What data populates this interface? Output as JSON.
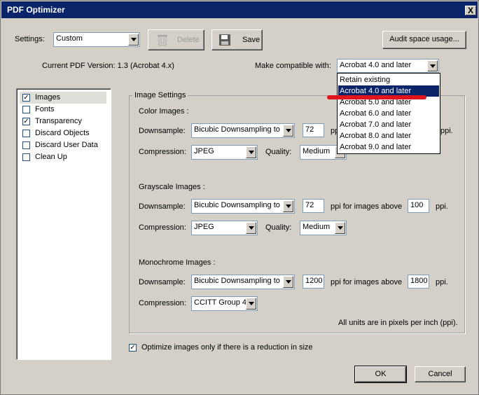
{
  "window": {
    "title": "PDF Optimizer",
    "close_glyph": "X"
  },
  "toolbar": {
    "settings_label": "Settings:",
    "settings_value": "Custom",
    "delete_label": "Delete",
    "save_label": "Save",
    "audit_label": "Audit space usage..."
  },
  "version": {
    "current": "Current PDF Version: 1.3 (Acrobat 4.x)",
    "compat_label": "Make compatible with:",
    "compat_value": "Acrobat 4.0 and later",
    "options": [
      "Retain existing",
      "Acrobat 4.0 and later",
      "Acrobat 5.0 and later",
      "Acrobat 6.0 and later",
      "Acrobat 7.0 and later",
      "Acrobat 8.0 and later",
      "Acrobat 9.0 and later"
    ]
  },
  "panels": [
    {
      "label": "Images",
      "checked": "✓"
    },
    {
      "label": "Fonts",
      "checked": ""
    },
    {
      "label": "Transparency",
      "checked": "✓"
    },
    {
      "label": "Discard Objects",
      "checked": ""
    },
    {
      "label": "Discard User Data",
      "checked": ""
    },
    {
      "label": "Clean Up",
      "checked": ""
    }
  ],
  "image_settings": {
    "group_label": "Image Settings",
    "color": {
      "header": "Color Images :",
      "downsample_label": "Downsample:",
      "downsample_value": "Bicubic Downsampling to",
      "ppi": "72",
      "ppi_above_label": "ppi for images above",
      "compression_label": "Compression:",
      "compression_value": "JPEG",
      "quality_label": "Quality:",
      "quality_value": "Medium",
      "ppi_suffix": "ppi."
    },
    "grayscale": {
      "header": "Grayscale Images :",
      "downsample_label": "Downsample:",
      "downsample_value": "Bicubic Downsampling to",
      "ppi": "72",
      "ppi_above_label": "ppi for images above",
      "ppi_above": "100",
      "ppi_suffix": "ppi.",
      "compression_label": "Compression:",
      "compression_value": "JPEG",
      "quality_label": "Quality:",
      "quality_value": "Medium"
    },
    "monochrome": {
      "header": "Monochrome Images :",
      "downsample_label": "Downsample:",
      "downsample_value": "Bicubic Downsampling to",
      "ppi": "1200",
      "ppi_above_label": "ppi for images above",
      "ppi_above": "1800",
      "ppi_suffix": "ppi.",
      "compression_label": "Compression:",
      "compression_value": "CCITT Group 4"
    },
    "units_note": "All units are in pixels per inch (ppi)."
  },
  "optimize_only": {
    "label": "Optimize images only if there is a reduction in size",
    "checked": "✓"
  },
  "footer": {
    "ok_label": "OK",
    "cancel_label": "Cancel"
  },
  "colors": {
    "titlebar": "#0a246a",
    "face": "#d4d0c8",
    "highlight": "#0a246a",
    "annotation": "#e0141c"
  }
}
